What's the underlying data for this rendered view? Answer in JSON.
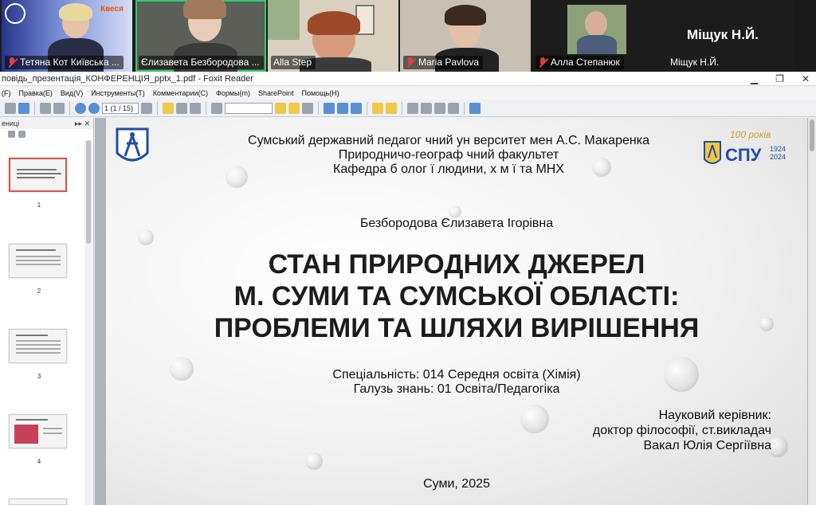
{
  "participants": [
    {
      "name": "Тетяна Кот Київська ...",
      "muted": true,
      "active": false
    },
    {
      "name": "Єлизавета Безбородова ...",
      "muted": false,
      "active": true
    },
    {
      "name": "Alla Step",
      "muted": false,
      "active": false
    },
    {
      "name": "Maria Pavlova",
      "muted": true,
      "active": false
    },
    {
      "name": "Алла Степанюк",
      "muted": true,
      "active": false
    },
    {
      "name": "Міщук Н.Й.",
      "muted": false,
      "active": false
    }
  ],
  "big_name": "Міщук Н.Й.",
  "tile1_logo_text": "Квеся",
  "window": {
    "title": "повідь_презентація_КОНФЕРЕНЦІЯ_pptx_1.pdf - Foxit Reader",
    "minimize": "▁",
    "restore": "❐",
    "close": "✕"
  },
  "menu": [
    "(F)",
    "Правка(E)",
    "Вид(V)",
    "Инструменты(T)",
    "Комментарии(C)",
    "Формы(m)",
    "SharePoint",
    "Помощь(H)"
  ],
  "toolbar": {
    "page_indicator": "1 (1 / 15)"
  },
  "sidebar": {
    "title": "ениці",
    "collapse": "▸▸ ✕",
    "pages": [
      "1",
      "2",
      "3",
      "4"
    ]
  },
  "slide": {
    "university": "Сумський державний педагог чний ун верситет  мен  А.С. Макаренка",
    "faculty": "Природничо-географ чний факультет",
    "department": "Кафедра б олог ї людини, х м ї та МНХ",
    "author": "Безбородова Єлизавета Ігорівна",
    "title_line1": "СТАН ПРИРОДНИХ ДЖЕРЕЛ",
    "title_line2": "М. СУМИ ТА СУМСЬКОЇ ОБЛАСТІ:",
    "title_line3": "ПРОБЛЕМИ ТА ШЛЯХИ ВИРІШЕННЯ",
    "specialty": "Спеціальність: 014 Середня освіта (Хімія)",
    "field": "Галузь знань: 01 Освіта/Педагогіка",
    "supervisor_label": "Науковий керівник:",
    "supervisor_title": "доктор філософії, ст.викладач",
    "supervisor_name": "Вакал Юлія Сергіївна",
    "city_year": "Суми, 2025",
    "logo_right_text": "СПУ",
    "logo_right_years": "100 років",
    "logo_right_dates": "1924 2024"
  },
  "colors": {
    "active_speaker": "#2ecc71",
    "muted_mic": "#e04040",
    "spu_blue": "#1f4fa3"
  }
}
